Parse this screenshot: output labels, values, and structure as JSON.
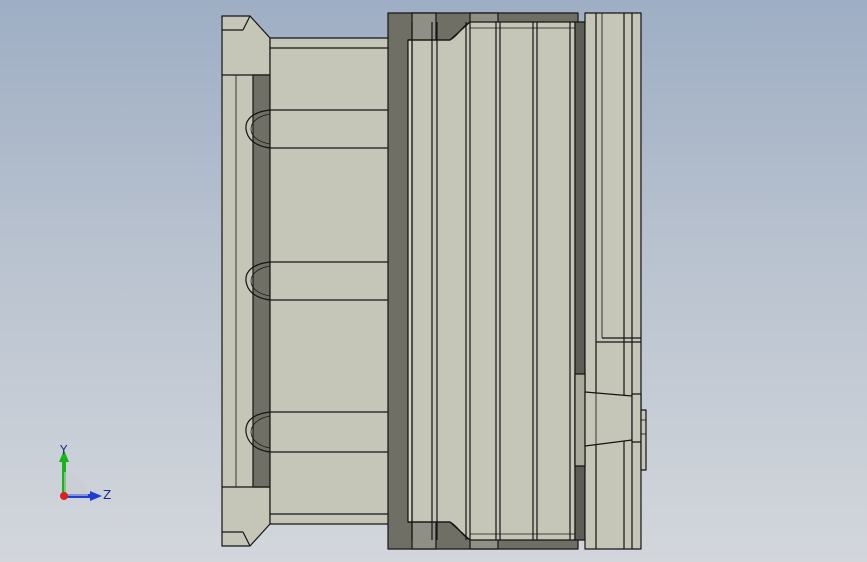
{
  "triad": {
    "y_label": "Y",
    "z_label": "Z",
    "colors": {
      "x": "#e02020",
      "y": "#19b419",
      "z": "#1d3fd6"
    }
  },
  "colors": {
    "body": "#c6c6b8",
    "body_dark": "#6f6f66",
    "edge": "#141414",
    "shadow": "#8f8f86"
  }
}
